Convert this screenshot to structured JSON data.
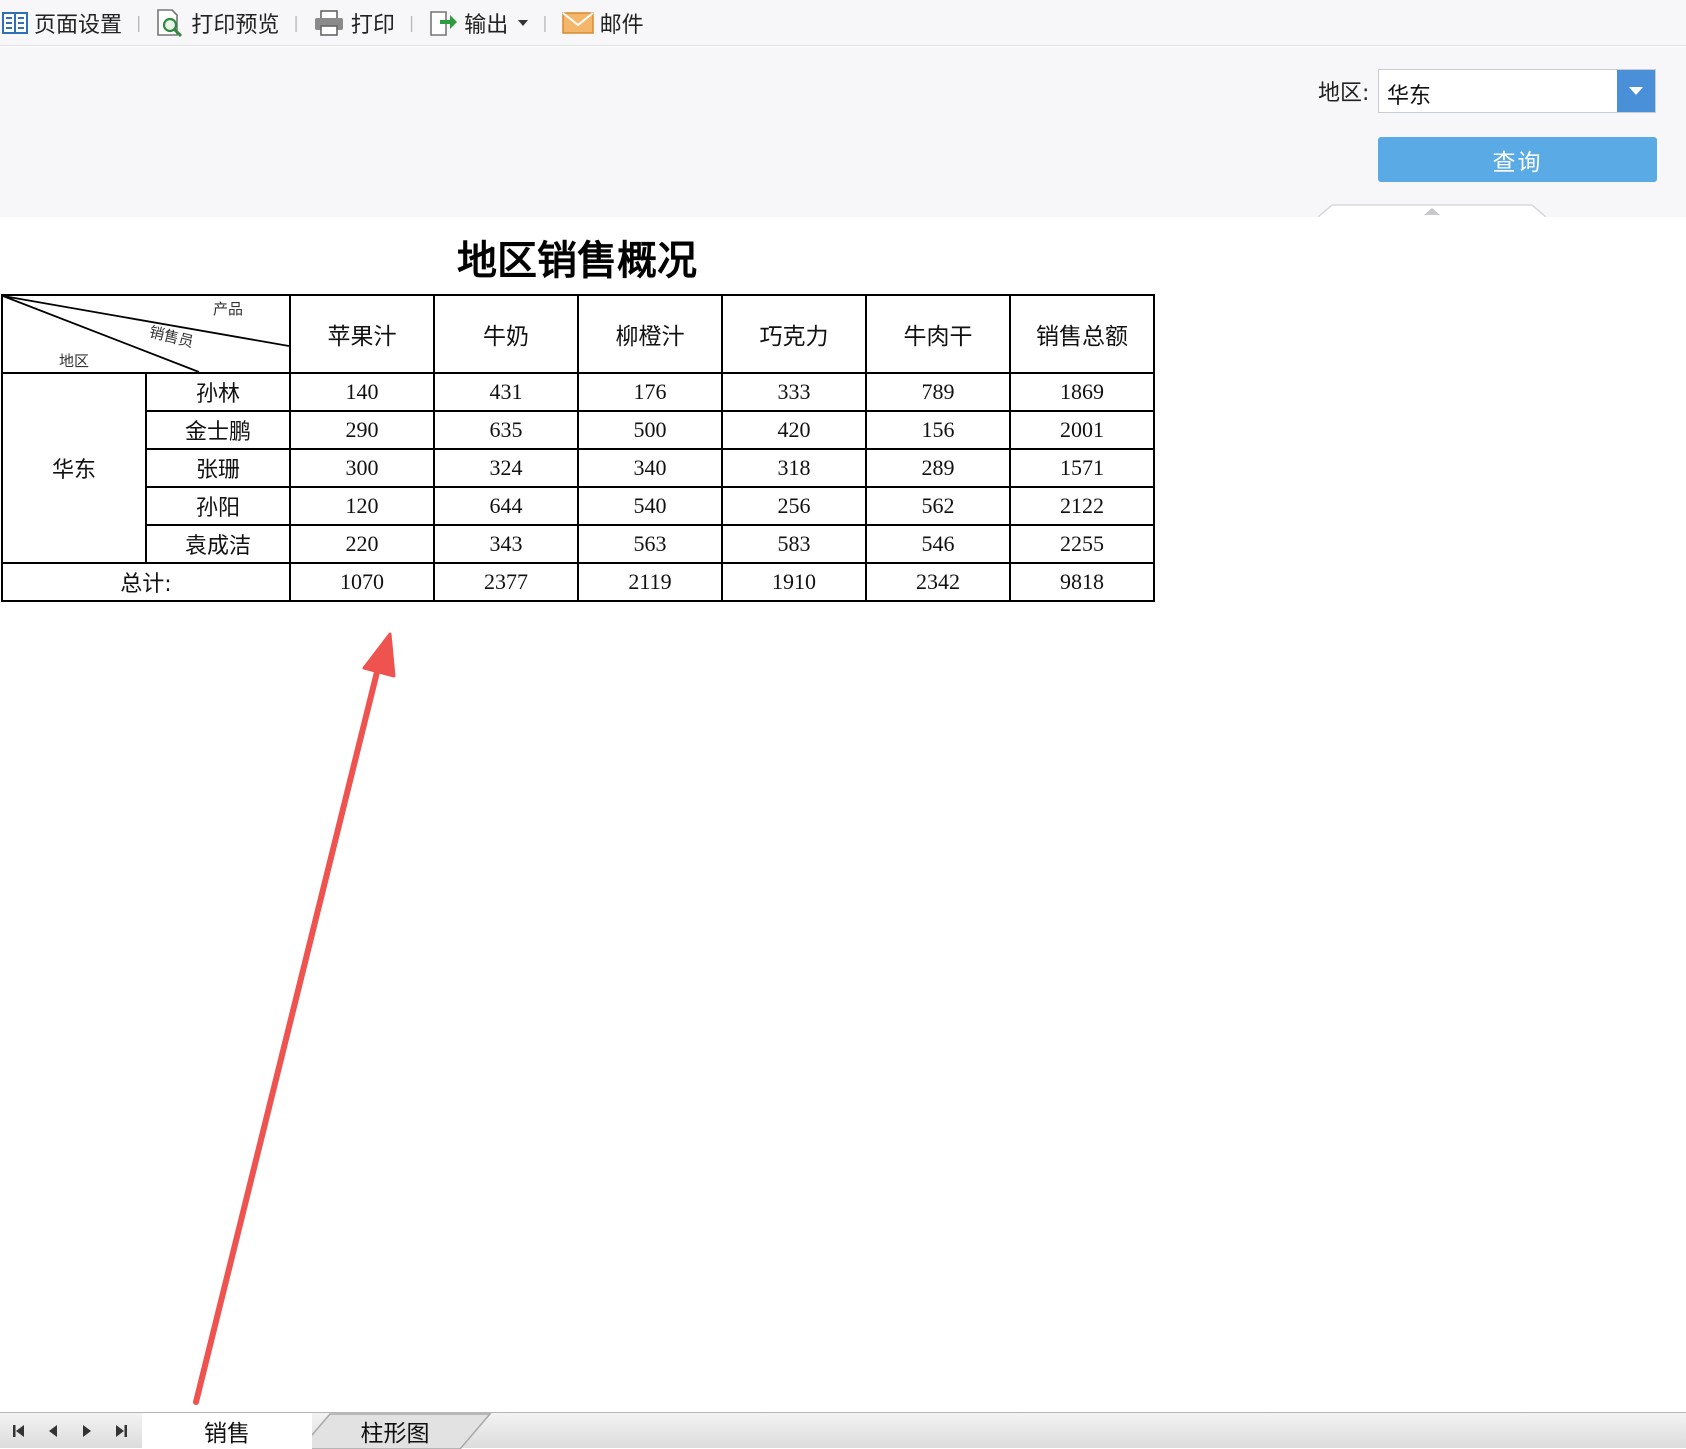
{
  "toolbar": {
    "page_setup": "页面设置",
    "print_preview": "打印预览",
    "print": "打印",
    "export": "输出",
    "mail": "邮件"
  },
  "params": {
    "region_label": "地区:",
    "region_value": "华东",
    "query_label": "查询"
  },
  "report": {
    "title": "地区销售概况",
    "corner": {
      "product": "产品",
      "salesperson": "销售员",
      "region": "地区"
    },
    "columns": [
      "苹果汁",
      "牛奶",
      "柳橙汁",
      "巧克力",
      "牛肉干",
      "销售总额"
    ],
    "region": "华东",
    "rows": [
      {
        "name": "孙林",
        "values": [
          "140",
          "431",
          "176",
          "333",
          "789",
          "1869"
        ]
      },
      {
        "name": "金士鹏",
        "values": [
          "290",
          "635",
          "500",
          "420",
          "156",
          "2001"
        ]
      },
      {
        "name": "张珊",
        "values": [
          "300",
          "324",
          "340",
          "318",
          "289",
          "1571"
        ]
      },
      {
        "name": "孙阳",
        "values": [
          "120",
          "644",
          "540",
          "256",
          "562",
          "2122"
        ]
      },
      {
        "name": "袁成洁",
        "values": [
          "220",
          "343",
          "563",
          "583",
          "546",
          "2255"
        ]
      }
    ],
    "total_label": "总计:",
    "totals": [
      "1070",
      "2377",
      "2119",
      "1910",
      "2342",
      "9818"
    ]
  },
  "sheets": {
    "tabs": [
      "销售",
      "柱形图"
    ]
  },
  "colors": {
    "accent": "#5aaae6",
    "dropdown": "#4a90d9",
    "arrow": "#ef5350"
  }
}
